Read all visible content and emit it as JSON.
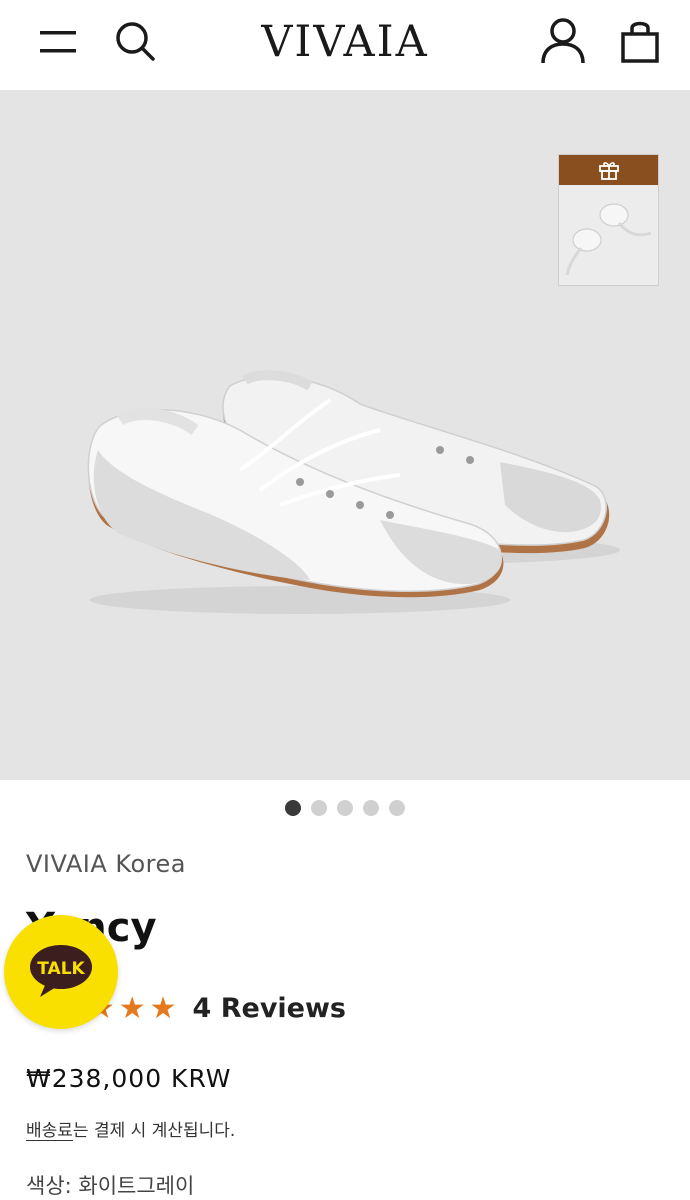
{
  "header": {
    "logo": "VIVAIA",
    "menu_icon": "hamburger-menu-icon",
    "search_icon": "search-icon",
    "account_icon": "user-icon",
    "bag_icon": "shopping-bag-icon"
  },
  "gallery": {
    "image_count": 5,
    "active_index": 0,
    "gift_icon": "gift-icon",
    "gift_color": "#8a4f1e"
  },
  "product": {
    "brand": "VIVAIA Korea",
    "title": "Yancy",
    "rating": 5,
    "reviews_label": "4 Reviews",
    "price": "₩238,000 KRW",
    "shipping_link": "배송료",
    "shipping_rest": "는 결제 시 계산됩니다.",
    "color_label": "색상: 화이트그레이",
    "star_color": "#e4791f"
  },
  "chat": {
    "label": "TALK",
    "bg_color": "#f9e000"
  }
}
